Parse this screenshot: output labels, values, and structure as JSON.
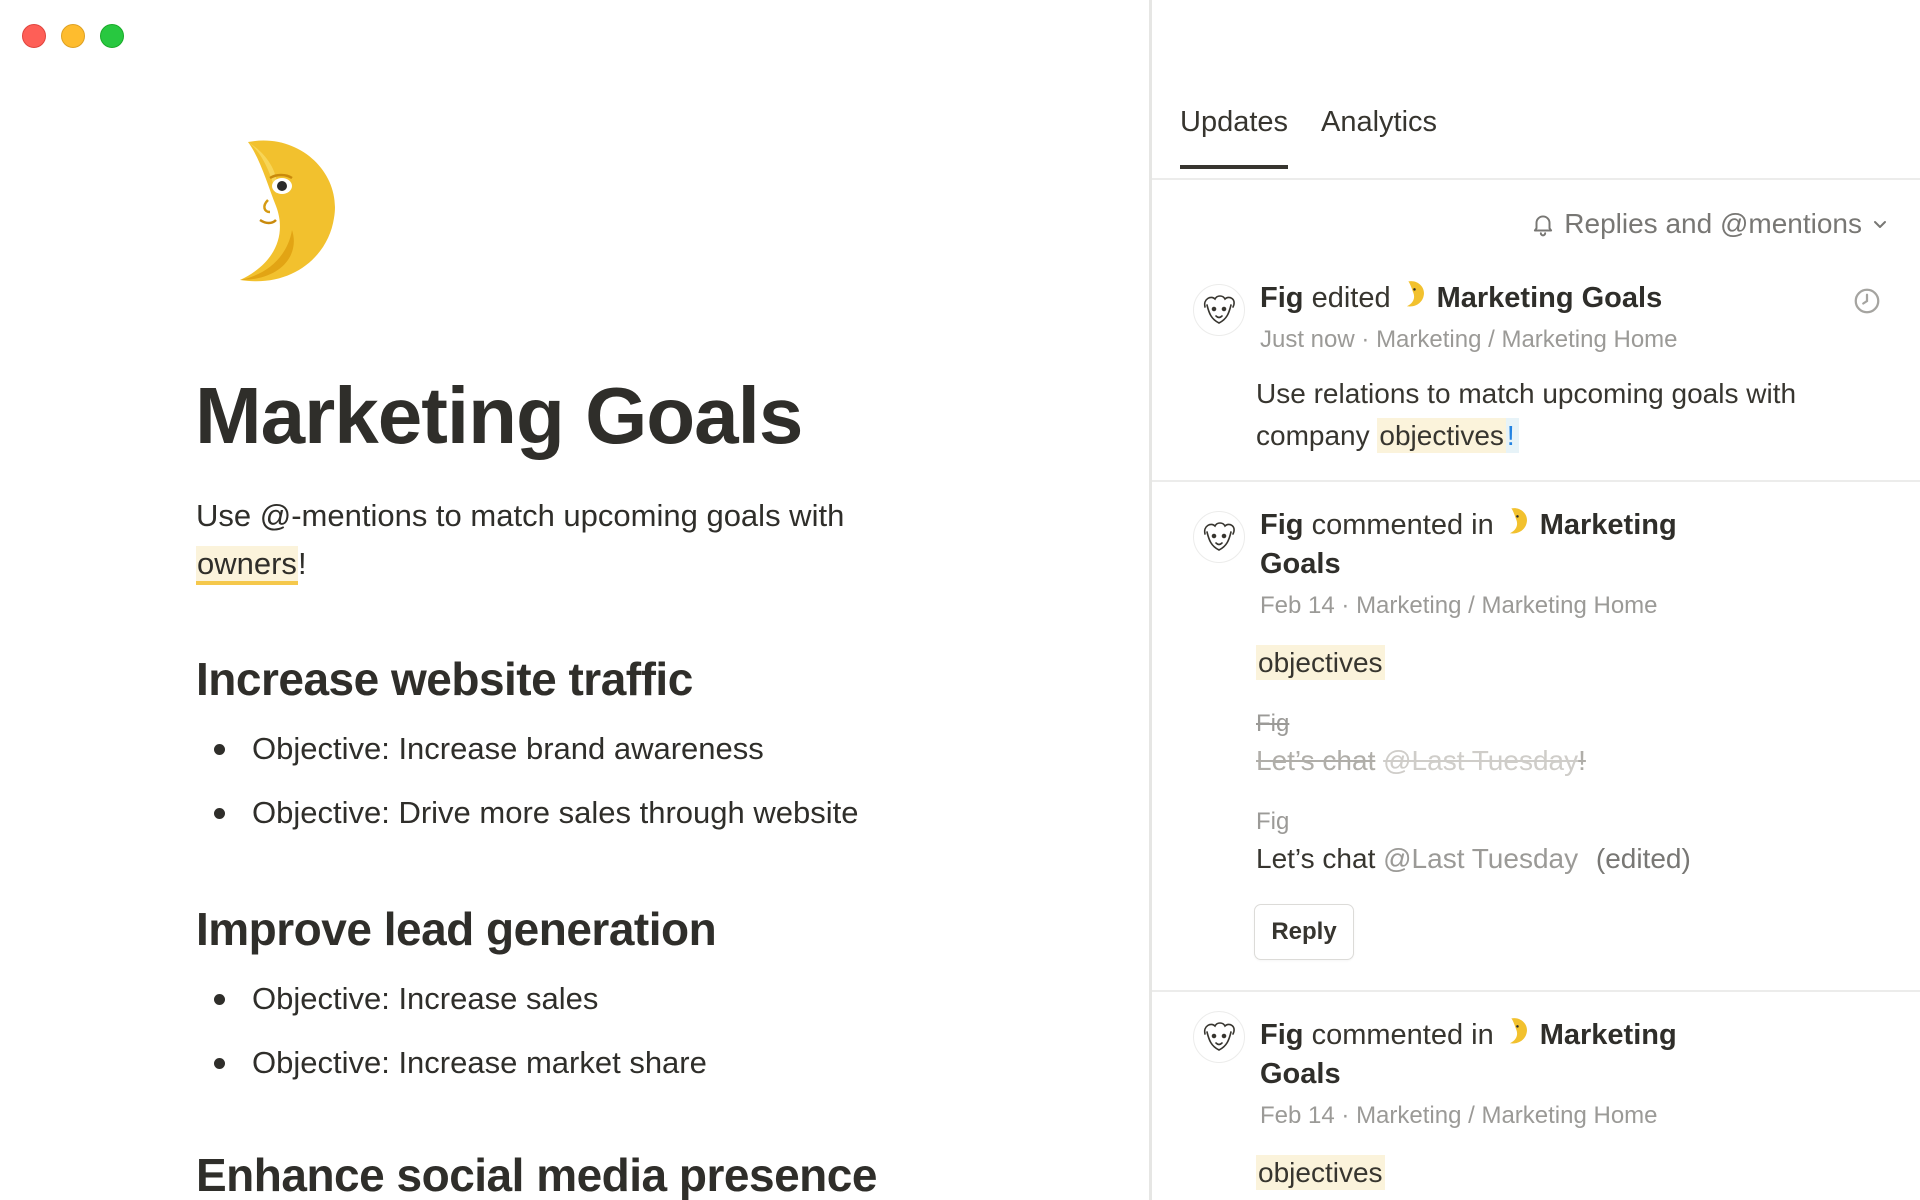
{
  "window": {
    "controls": [
      "close",
      "minimize",
      "maximize"
    ]
  },
  "page": {
    "icon": "crescent-moon-face-icon",
    "title": "Marketing Goals",
    "intro_text": "Use @-mentions to match upcoming goals with",
    "intro_highlight": "owners",
    "intro_end": "!",
    "sections": [
      {
        "heading": "Increase website traffic",
        "items": [
          "Objective: Increase brand awareness",
          "Objective: Drive more sales through website"
        ]
      },
      {
        "heading": "Improve lead generation",
        "items": [
          "Objective: Increase sales",
          "Objective: Increase market share"
        ]
      },
      {
        "heading": "Enhance social media presence",
        "items": []
      }
    ]
  },
  "panel": {
    "tabs": [
      {
        "label": "Updates",
        "active": true
      },
      {
        "label": "Analytics",
        "active": false
      }
    ],
    "filter_label": "Replies and @mentions",
    "updates": [
      {
        "author": "Fig",
        "action": "edited",
        "page": "Marketing Goals",
        "time": "Just now",
        "path_sep": "·",
        "path_1": "Marketing",
        "path_slash": "/",
        "path_2": "Marketing Home",
        "body_text": "Use relations to match upcoming goals with company",
        "body_highlight": "objectives",
        "body_end": "!"
      },
      {
        "author": "Fig",
        "action": "commented in",
        "page_line1": "Marketing",
        "page_line2": "Goals",
        "time": "Feb 14",
        "path_sep": "·",
        "path_1": "Marketing",
        "path_slash": "/",
        "path_2": "Marketing Home",
        "quote": "objectives",
        "old_author": "Fig",
        "old_text": "Let’s chat",
        "old_mention": "@Last Tuesday",
        "old_end": "!",
        "new_author": "Fig",
        "new_text": "Let’s chat",
        "new_mention": "@Last Tuesday",
        "edited_label": "(edited)",
        "reply_label": "Reply"
      },
      {
        "author": "Fig",
        "action": "commented in",
        "page_line1": "Marketing",
        "page_line2": "Goals",
        "time": "Feb 14",
        "path_sep": "·",
        "path_1": "Marketing",
        "path_slash": "/",
        "path_2": "Marketing Home",
        "quote": "objectives"
      }
    ]
  },
  "colors": {
    "text": "#37352f",
    "muted": "#9b9a97",
    "highlight_yellow": "#fbf3db",
    "underline_yellow": "#f5c84b",
    "link_blue": "#2383e2"
  }
}
